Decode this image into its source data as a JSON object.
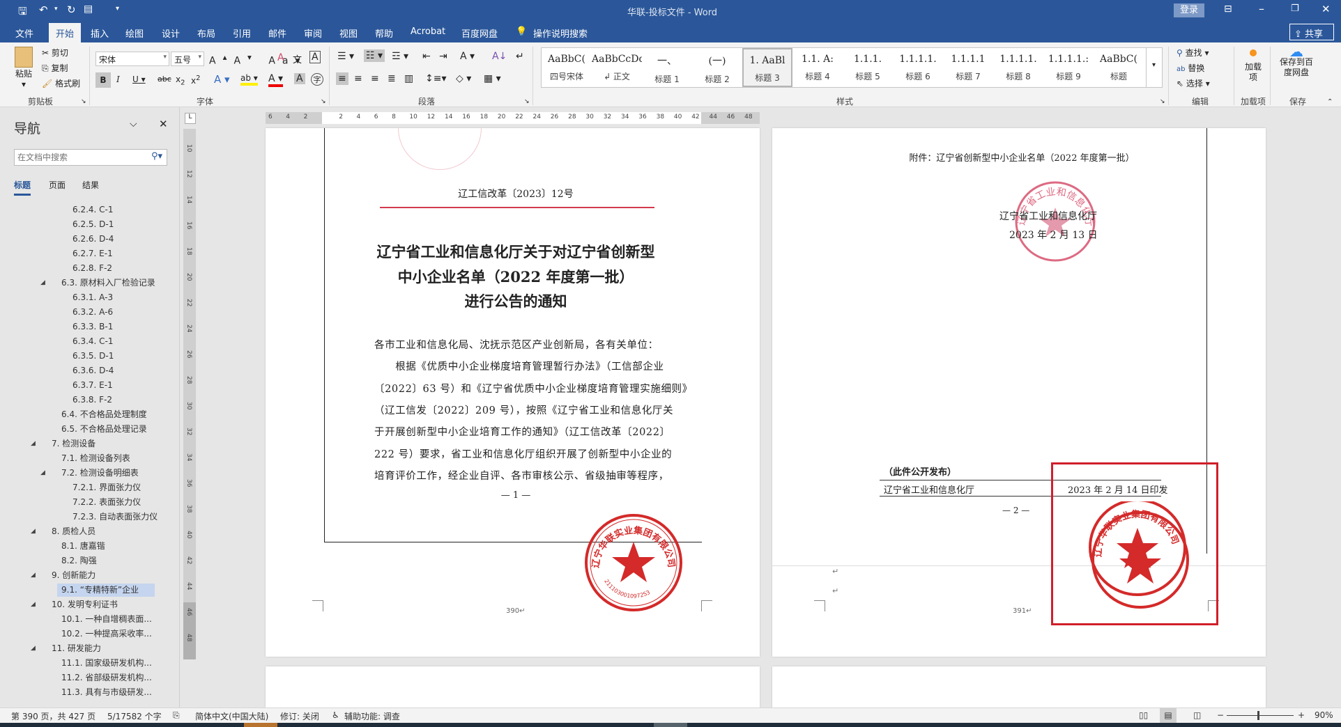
{
  "window": {
    "title": "华联-投标文件  -  Word",
    "login": "登录",
    "share": "共享"
  },
  "tabs": [
    "文件",
    "开始",
    "插入",
    "绘图",
    "设计",
    "布局",
    "引用",
    "邮件",
    "审阅",
    "视图",
    "帮助",
    "Acrobat",
    "百度网盘"
  ],
  "tell_me": "操作说明搜索",
  "ribbon": {
    "clipboard": {
      "label": "剪贴板",
      "paste": "粘贴",
      "cut": "剪切",
      "copy": "复制",
      "format_painter": "格式刷"
    },
    "font": {
      "label": "字体",
      "font_name": "宋体",
      "font_size": "五号"
    },
    "paragraph": {
      "label": "段落"
    },
    "styles": {
      "label": "样式",
      "items": [
        {
          "preview": "AaBbC(",
          "name": "四号宋体"
        },
        {
          "preview": "AaBbCcDdI",
          "name": "↲ 正文"
        },
        {
          "preview": "一、",
          "name": "标题 1"
        },
        {
          "preview": "(一)",
          "name": "标题 2"
        },
        {
          "preview": "1.  AaBl",
          "name": "标题 3"
        },
        {
          "preview": "1.1.  A:",
          "name": "标题 4"
        },
        {
          "preview": "1.1.1.",
          "name": "标题 5"
        },
        {
          "preview": "1.1.1.1.",
          "name": "标题 6"
        },
        {
          "preview": "1.1.1.1",
          "name": "标题 7"
        },
        {
          "preview": "1.1.1.1.",
          "name": "标题 8"
        },
        {
          "preview": "1.1.1.1.:",
          "name": "标题 9"
        },
        {
          "preview": "AaBbC(",
          "name": "标题"
        }
      ]
    },
    "editing": {
      "label": "编辑",
      "find": "查找",
      "replace": "替换",
      "select": "选择"
    },
    "addins": {
      "label": "加载项",
      "button": "加载项"
    },
    "save": {
      "label": "保存",
      "button": "保存到百度网盘"
    }
  },
  "nav": {
    "title": "导航",
    "search_placeholder": "在文档中搜索",
    "tabs": [
      "标题",
      "页面",
      "结果"
    ],
    "items": [
      {
        "text": "6.2.4. C-1",
        "level": 3
      },
      {
        "text": "6.2.5. D-1",
        "level": 3
      },
      {
        "text": "6.2.6. D-4",
        "level": 3
      },
      {
        "text": "6.2.7. E-1",
        "level": 3
      },
      {
        "text": "6.2.8. F-2",
        "level": 3
      },
      {
        "text": "6.3. 原材料入厂检验记录",
        "level": 2,
        "expanded": true
      },
      {
        "text": "6.3.1. A-3",
        "level": 3
      },
      {
        "text": "6.3.2. A-6",
        "level": 3
      },
      {
        "text": "6.3.3. B-1",
        "level": 3
      },
      {
        "text": "6.3.4. C-1",
        "level": 3
      },
      {
        "text": "6.3.5. D-1",
        "level": 3
      },
      {
        "text": "6.3.6. D-4",
        "level": 3
      },
      {
        "text": "6.3.7. E-1",
        "level": 3
      },
      {
        "text": "6.3.8. F-2",
        "level": 3
      },
      {
        "text": "6.4. 不合格品处理制度",
        "level": 2
      },
      {
        "text": "6.5. 不合格品处理记录",
        "level": 2
      },
      {
        "text": "7. 检测设备",
        "level": 1,
        "expanded": true
      },
      {
        "text": "7.1. 检测设备列表",
        "level": 2
      },
      {
        "text": "7.2. 检测设备明细表",
        "level": 2,
        "expanded": true
      },
      {
        "text": "7.2.1. 界面张力仪",
        "level": 3
      },
      {
        "text": "7.2.2. 表面张力仪",
        "level": 3
      },
      {
        "text": "7.2.3. 自动表面张力仪",
        "level": 3
      },
      {
        "text": "8. 质检人员",
        "level": 1,
        "expanded": true
      },
      {
        "text": "8.1. 唐嘉锴",
        "level": 2
      },
      {
        "text": "8.2. 陶强",
        "level": 2
      },
      {
        "text": "9. 创新能力",
        "level": 1,
        "expanded": true
      },
      {
        "text": "9.1. “专精特新”企业",
        "level": 2,
        "selected": true
      },
      {
        "text": "10. 发明专利证书",
        "level": 1,
        "expanded": true
      },
      {
        "text": "10.1. 一种自增稠表面...",
        "level": 2
      },
      {
        "text": "10.2. 一种提高采收率...",
        "level": 2
      },
      {
        "text": "11. 研发能力",
        "level": 1,
        "expanded": true
      },
      {
        "text": "11.1. 国家级研发机构...",
        "level": 2
      },
      {
        "text": "11.2. 省部级研发机构...",
        "level": 2
      },
      {
        "text": "11.3. 具有与市级研发...",
        "level": 2
      }
    ]
  },
  "ruler": {
    "h": [
      "6",
      "4",
      "2",
      "",
      "2",
      "4",
      "6",
      "8",
      "10",
      "12",
      "14",
      "16",
      "18",
      "20",
      "22",
      "24",
      "26",
      "28",
      "30",
      "32",
      "34",
      "36",
      "38",
      "40",
      "42",
      "44",
      "46",
      "48"
    ],
    "v": [
      "10",
      "12",
      "14",
      "16",
      "18",
      "20",
      "22",
      "24",
      "26",
      "28",
      "30",
      "32",
      "34",
      "36",
      "38",
      "40",
      "42",
      "44",
      "46",
      "48"
    ]
  },
  "page1": {
    "doc_no": "辽工信改革〔2023〕12号",
    "title": [
      "辽宁省工业和信息化厅关于对辽宁省创新型",
      "中小企业名单（2022 年度第一批）",
      "进行公告的通知"
    ],
    "body": [
      "各市工业和信息化局、沈抚示范区产业创新局，各有关单位：",
      "　　根据《优质中小企业梯度培育管理暂行办法》（工信部企业",
      "〔2022〕63 号）和《辽宁省优质中小企业梯度培育管理实施细则》",
      "（辽工信发〔2022〕209 号），按照《辽宁省工业和信息化厅关",
      "于开展创新型中小企业培育工作的通知》（辽工信改革〔2022〕",
      "222 号）要求，省工业和信息化厅组织开展了创新型中小企业的",
      "培育评价工作，经企业自评、各市审核公示、省级抽审等程序，"
    ],
    "page_mark": "— 1 —",
    "page_number": "390↵",
    "stamp_text": "辽宁华联实业集团有限公司",
    "stamp_code": "2111030010972S3"
  },
  "page2": {
    "attachment": "附件：辽宁省创新型中小企业名单（2022 年度第一批）",
    "issuer": "辽宁省工业和信息化厅",
    "issue_date": "2023 年 2 月 13 日",
    "publish_note": "（此件公开发布）",
    "footer_org": "辽宁省工业和信息化厅",
    "footer_date": "2023 年 2 月 14 日印发",
    "page_mark": "— 2 —",
    "page_number": "391↵",
    "para_marks": [
      "↵",
      "↵"
    ],
    "stamp_issuer_text": "辽宁省工业和信息化厅"
  },
  "status": {
    "page": "第 390 页，共 427 页",
    "words": "5/17582 个字",
    "language": "简体中文(中国大陆)",
    "track": "修订: 关闭",
    "accessibility": "辅助功能: 调查",
    "zoom": "90%"
  },
  "colors": {
    "brand": "#2b579a",
    "stamp": "#d42a2a",
    "highlight_box": "#d01f2a"
  }
}
